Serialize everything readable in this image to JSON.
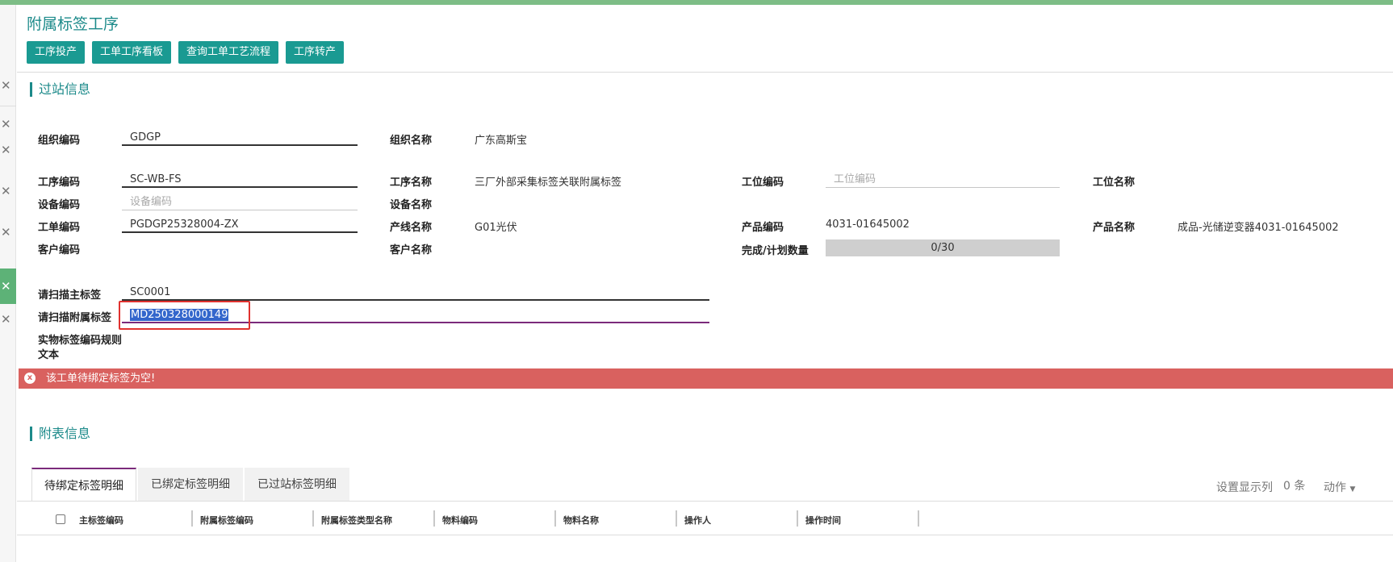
{
  "page_title": "附属标签工序",
  "buttons": [
    "工序投产",
    "工单工序看板",
    "查询工单工艺流程",
    "工序转产"
  ],
  "sections": {
    "station": "过站信息",
    "detail": "附表信息"
  },
  "fields": {
    "org_code": {
      "label": "组织编码",
      "value": "GDGP"
    },
    "org_name": {
      "label": "组织名称",
      "value": "广东高斯宝"
    },
    "process_code": {
      "label": "工序编码",
      "value": "SC-WB-FS"
    },
    "process_name": {
      "label": "工序名称",
      "value": "三厂外部采集标签关联附属标签"
    },
    "station_code": {
      "label": "工位编码",
      "placeholder": "工位编码"
    },
    "station_name": {
      "label": "工位名称"
    },
    "device_code": {
      "label": "设备编码",
      "placeholder": "设备编码"
    },
    "device_name": {
      "label": "设备名称"
    },
    "work_order": {
      "label": "工单编码",
      "value": "PGDGP25328004-ZX"
    },
    "line_name": {
      "label": "产线名称",
      "value": "G01光伏"
    },
    "product_code": {
      "label": "产品编码",
      "value": "4031-01645002"
    },
    "product_name": {
      "label": "产品名称",
      "value": "成品-光储逆变器4031-01645002"
    },
    "customer_code": {
      "label": "客户编码"
    },
    "customer_name": {
      "label": "客户名称"
    },
    "progress": {
      "label": "完成/计划数量",
      "value": "0/30",
      "completed": 0,
      "planned": 30
    },
    "main_tag": {
      "label": "请扫描主标签",
      "value": "SC0001"
    },
    "sub_tag": {
      "label": "请扫描附属标签",
      "value": "MD250328000149"
    },
    "rule_text": {
      "label_line1": "实物标签编码规则",
      "label_line2": "文本"
    }
  },
  "alert": {
    "icon": "error-icon",
    "text": "该工单待绑定标签为空!"
  },
  "tabs": [
    "待绑定标签明细",
    "已绑定标签明细",
    "已过站标签明细"
  ],
  "toolbar": {
    "columns_setting": "设置显示列",
    "count": "0 条",
    "actions": "动作"
  },
  "table_headers": [
    "主标签编码",
    "附属标签编码",
    "附属标签类型名称",
    "物料编码",
    "物料名称",
    "操作人",
    "操作时间"
  ],
  "colors": {
    "accent": "#1a9a92",
    "title": "#1c8a8a",
    "alert": "#d9615f",
    "topbar": "#7dbd86",
    "active_tab": "#7b2a7b"
  }
}
